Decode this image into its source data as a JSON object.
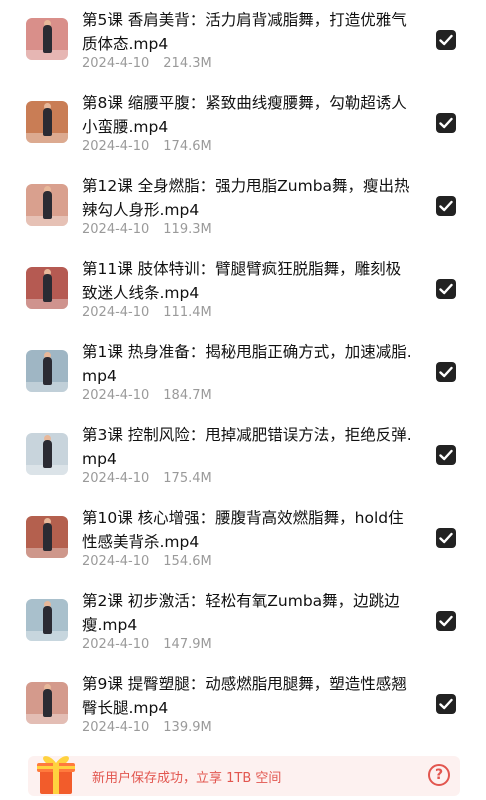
{
  "files": [
    {
      "title": "第5课 香肩美背：活力肩背减脂舞，打造优雅气质体态.mp4",
      "date": "2024-4-10",
      "size": "214.3M",
      "thumb_color": "#d98f8a",
      "checked": true
    },
    {
      "title": "第8课 缩腰平腹：紧致曲线瘦腰舞，勾勒超诱人小蛮腰.mp4",
      "date": "2024-4-10",
      "size": "174.6M",
      "thumb_color": "#c97d55",
      "checked": true
    },
    {
      "title": "第12课 全身燃脂：强力甩脂Zumba舞，瘦出热辣勾人身形.mp4",
      "date": "2024-4-10",
      "size": "119.3M",
      "thumb_color": "#d9a08e",
      "checked": true
    },
    {
      "title": "第11课 肢体特训：臂腿臂疯狂脱脂舞，雕刻极致迷人线条.mp4",
      "date": "2024-4-10",
      "size": "111.4M",
      "thumb_color": "#b55a52",
      "checked": true
    },
    {
      "title": "第1课 热身准备：揭秘甩脂正确方式，加速减脂.mp4",
      "date": "2024-4-10",
      "size": "184.7M",
      "thumb_color": "#9fb6c4",
      "checked": true
    },
    {
      "title": "第3课 控制风险：甩掉减肥错误方法，拒绝反弹.mp4",
      "date": "2024-4-10",
      "size": "175.4M",
      "thumb_color": "#c8d4dc",
      "checked": true
    },
    {
      "title": "第10课 核心增强：腰腹背高效燃脂舞，hold住性感美背杀.mp4",
      "date": "2024-4-10",
      "size": "154.6M",
      "thumb_color": "#b4604e",
      "checked": true
    },
    {
      "title": "第2课 初步激活：轻松有氧Zumba舞，边跳边瘦.mp4",
      "date": "2024-4-10",
      "size": "147.9M",
      "thumb_color": "#a9c0cc",
      "checked": true
    },
    {
      "title": "第9课 提臀塑腿：动感燃脂甩腿舞，塑造性感翘臀长腿.mp4",
      "date": "2024-4-10",
      "size": "139.9M",
      "thumb_color": "#d49a8c",
      "checked": true
    }
  ],
  "banner": {
    "text": "新用户保存成功，立享 1TB 空间",
    "help_symbol": "?",
    "accent_color": "#e2564f"
  },
  "icons": {
    "checkbox": "check-icon",
    "gift": "gift-icon",
    "help": "help-circle-icon"
  }
}
